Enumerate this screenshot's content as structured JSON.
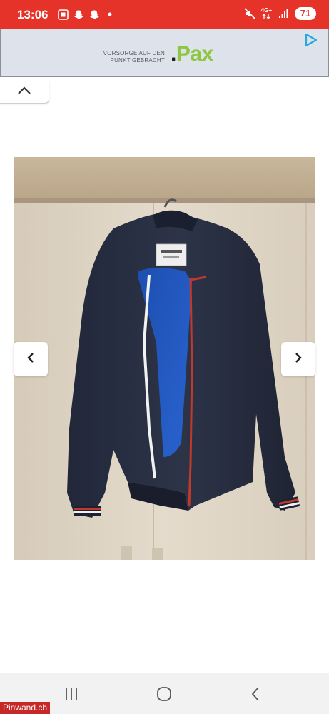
{
  "status_bar": {
    "time": "13:06",
    "network": "4G+",
    "battery": "71",
    "left_icons": [
      "screenshot-icon",
      "snapchat-icon",
      "snapchat-icon",
      "dot-icon"
    ],
    "right_icons": [
      "mute-icon",
      "network-4g-icon",
      "signal-icon",
      "battery-icon"
    ]
  },
  "ad": {
    "tagline_line1": "VORSORGE AUF DEN",
    "tagline_line2": "PUNKT GEBRACHT",
    "brand_dot": ".",
    "brand_name": "Pax",
    "icon": "ad-play-icon",
    "brand_color": "#8dc63f"
  },
  "collapse_icon": "chevron-up-icon",
  "gallery": {
    "prev_icon": "chevron-left-icon",
    "next_icon": "chevron-right-icon",
    "image_subject": "jacket"
  },
  "system_nav": {
    "recents_icon": "recents-icon",
    "home_icon": "home-icon",
    "back_icon": "back-icon"
  },
  "watermark": "Pinwand.ch",
  "colors": {
    "status_bar": "#e5332a",
    "ad_background": "#dee2ea",
    "watermark": "#c62828"
  }
}
